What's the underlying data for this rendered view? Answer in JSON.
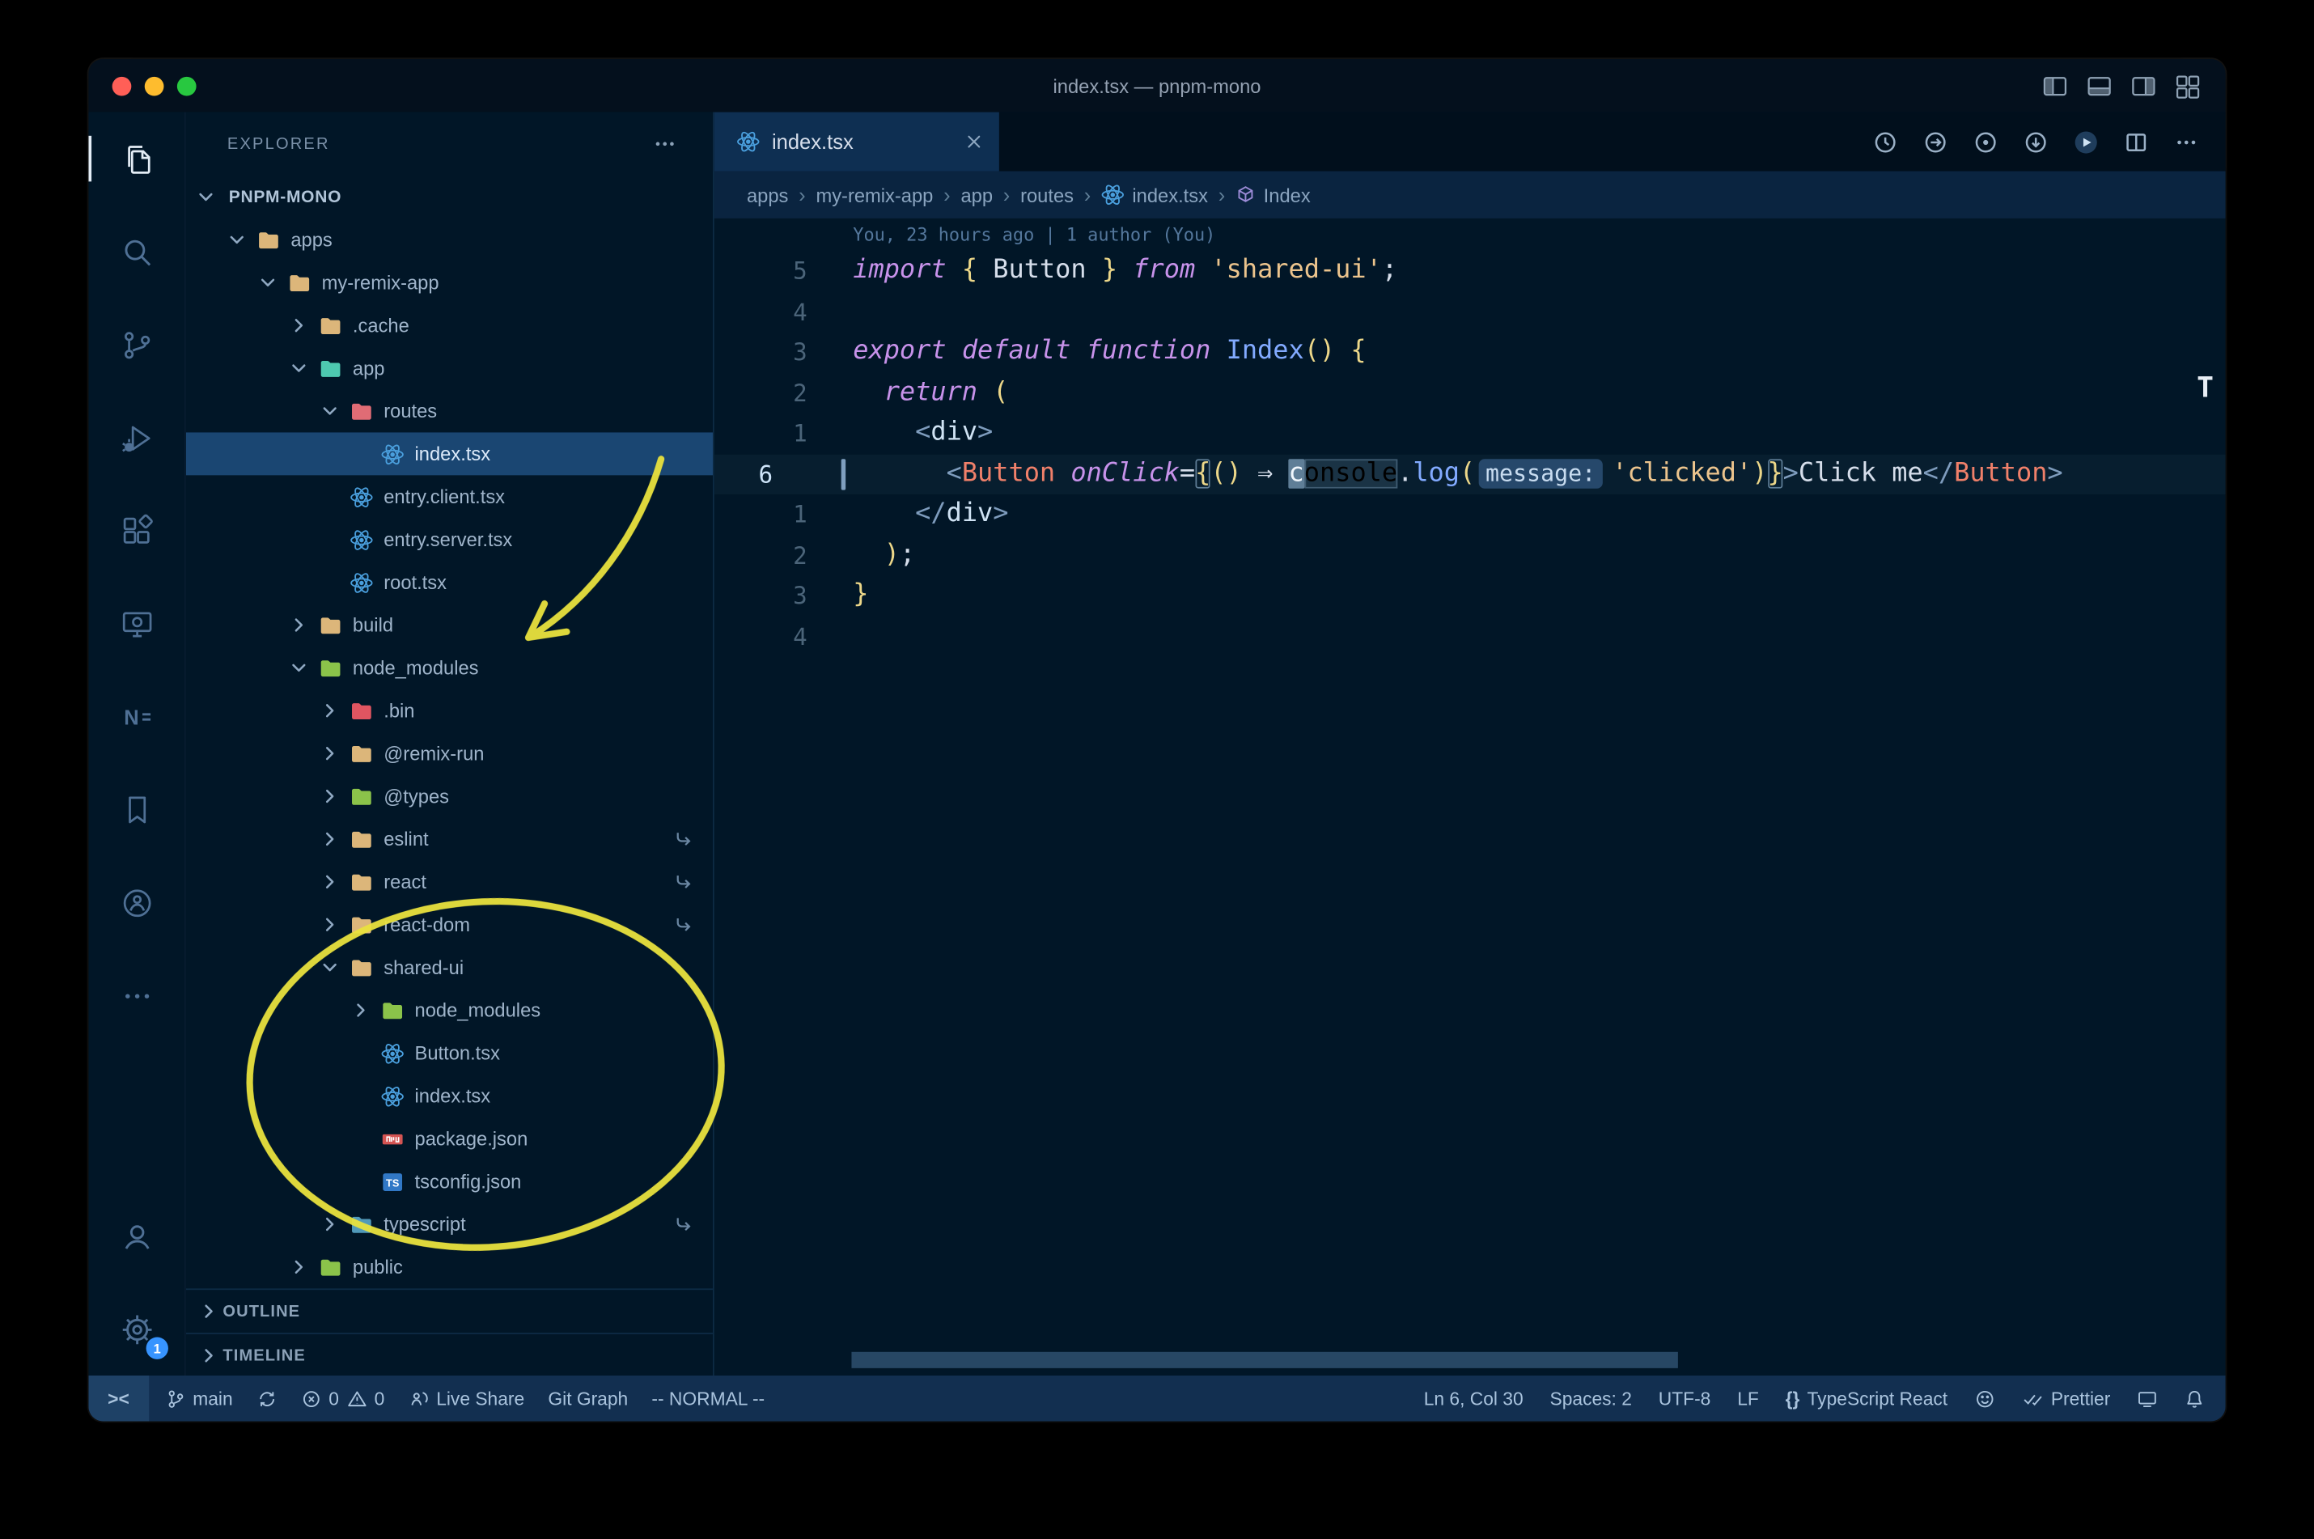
{
  "window": {
    "title": "index.tsx — pnpm-mono"
  },
  "colors": {
    "background": "#011627",
    "annotation_yellow": "#e9e23e",
    "selected_row": "#1a4672",
    "badge_blue": "#3794ff",
    "folder_default": "#dcb67a",
    "folder_node_modules": "#8bc34a",
    "folder_app": "#4ec9b0",
    "folder_routes": "#e06c75",
    "folder_bin": "#e05561",
    "folder_typescript": "#519aba",
    "react_icon": "#4a9fdd",
    "npm_icon": "#d45453",
    "ts_icon": "#3178c6",
    "keyword": "#c792ea",
    "string": "#ecc48d",
    "function": "#82aaff",
    "component": "#f0806a",
    "bracket": "#ecd789",
    "traffic_lights": [
      "#ff5f57",
      "#febc2e",
      "#28c840"
    ]
  },
  "icons_legend": {
    "remote-indicator": "><",
    "language-braces": "{}",
    "breadcrumb-separator": "›",
    "close": "×",
    "chevron-expanded": "⌄",
    "chevron-collapsed": "›",
    "symlink": "↪"
  },
  "activity_bar": {
    "top": [
      {
        "icon": "explorer",
        "active": true
      },
      {
        "icon": "search"
      },
      {
        "icon": "source-control"
      },
      {
        "icon": "run-debug"
      },
      {
        "icon": "extensions"
      },
      {
        "icon": "remote-explorer"
      },
      {
        "icon": "nx-console"
      },
      {
        "icon": "bookmarks"
      },
      {
        "icon": "live-share"
      },
      {
        "icon": "more"
      }
    ],
    "bottom": [
      {
        "icon": "accounts"
      },
      {
        "icon": "settings",
        "badge": "1"
      }
    ]
  },
  "sidebar": {
    "title": "EXPLORER",
    "bottom_sections": [
      "OUTLINE",
      "TIMELINE"
    ],
    "tree": [
      {
        "label": "PNPM-MONO",
        "depth": 0,
        "kind": "root",
        "state": "open"
      },
      {
        "label": "apps",
        "depth": 1,
        "kind": "folder",
        "color": "#dcb67a",
        "state": "open"
      },
      {
        "label": "my-remix-app",
        "depth": 2,
        "kind": "folder",
        "color": "#dcb67a",
        "state": "open"
      },
      {
        "label": ".cache",
        "depth": 3,
        "kind": "folder",
        "color": "#dcb67a",
        "state": "closed"
      },
      {
        "label": "app",
        "depth": 3,
        "kind": "folder",
        "color": "#4ec9b0",
        "state": "open"
      },
      {
        "label": "routes",
        "depth": 4,
        "kind": "folder",
        "color": "#e06c75",
        "state": "open"
      },
      {
        "label": "index.tsx",
        "depth": 5,
        "kind": "file",
        "icon": "react",
        "selected": true
      },
      {
        "label": "entry.client.tsx",
        "depth": 4,
        "kind": "file",
        "icon": "react"
      },
      {
        "label": "entry.server.tsx",
        "depth": 4,
        "kind": "file",
        "icon": "react"
      },
      {
        "label": "root.tsx",
        "depth": 4,
        "kind": "file",
        "icon": "react"
      },
      {
        "label": "build",
        "depth": 3,
        "kind": "folder",
        "color": "#dcb67a",
        "state": "closed"
      },
      {
        "label": "node_modules",
        "depth": 3,
        "kind": "folder",
        "color": "#8bc34a",
        "state": "open"
      },
      {
        "label": ".bin",
        "depth": 4,
        "kind": "folder",
        "color": "#e05561",
        "state": "closed"
      },
      {
        "label": "@remix-run",
        "depth": 4,
        "kind": "folder",
        "color": "#dcb67a",
        "state": "closed"
      },
      {
        "label": "@types",
        "depth": 4,
        "kind": "folder",
        "color": "#8bc34a",
        "state": "closed"
      },
      {
        "label": "eslint",
        "depth": 4,
        "kind": "folder",
        "color": "#dcb67a",
        "state": "closed",
        "symlink": true
      },
      {
        "label": "react",
        "depth": 4,
        "kind": "folder",
        "color": "#dcb67a",
        "state": "closed",
        "symlink": true
      },
      {
        "label": "react-dom",
        "depth": 4,
        "kind": "folder",
        "color": "#dcb67a",
        "state": "closed",
        "symlink": true
      },
      {
        "label": "shared-ui",
        "depth": 4,
        "kind": "folder",
        "color": "#dcb67a",
        "state": "open"
      },
      {
        "label": "node_modules",
        "depth": 5,
        "kind": "folder",
        "color": "#8bc34a",
        "state": "closed"
      },
      {
        "label": "Button.tsx",
        "depth": 5,
        "kind": "file",
        "icon": "react"
      },
      {
        "label": "index.tsx",
        "depth": 5,
        "kind": "file",
        "icon": "react"
      },
      {
        "label": "package.json",
        "depth": 5,
        "kind": "file",
        "icon": "npm"
      },
      {
        "label": "tsconfig.json",
        "depth": 5,
        "kind": "file",
        "icon": "ts"
      },
      {
        "label": "typescript",
        "depth": 4,
        "kind": "folder",
        "color": "#519aba",
        "state": "closed",
        "symlink": true
      },
      {
        "label": "public",
        "depth": 3,
        "kind": "folder",
        "color": "#8bc34a",
        "state": "closed"
      }
    ]
  },
  "editor": {
    "tab": {
      "label": "index.tsx",
      "icon": "react"
    },
    "actions": [
      {
        "name": "history",
        "icon": "history"
      },
      {
        "name": "open-changes",
        "icon": "open-changes"
      },
      {
        "name": "circle-dot",
        "icon": "target"
      },
      {
        "name": "circle-arrow",
        "icon": "target-arrow"
      },
      {
        "name": "run",
        "icon": "run"
      },
      {
        "name": "split-editor",
        "icon": "split"
      },
      {
        "name": "more-actions",
        "icon": "ellipsis"
      }
    ],
    "breadcrumb_separator": "›",
    "breadcrumbs": [
      {
        "label": "apps"
      },
      {
        "label": "my-remix-app"
      },
      {
        "label": "app"
      },
      {
        "label": "routes"
      },
      {
        "label": "index.tsx",
        "icon": "react"
      },
      {
        "label": "Index",
        "icon": "symbol"
      }
    ],
    "blame": "You, 23 hours ago | 1 author (You)",
    "overview_marker": "T",
    "code": {
      "lines": [
        {
          "num": "5",
          "tokens": [
            [
              "import",
              "kw"
            ],
            [
              " ",
              "pl"
            ],
            [
              "{",
              "br"
            ],
            [
              " Button ",
              "pl"
            ],
            [
              "}",
              "br"
            ],
            [
              " ",
              "pl"
            ],
            [
              "from",
              "kw"
            ],
            [
              " ",
              "pl"
            ],
            [
              "'shared-ui'",
              "str"
            ],
            [
              ";",
              "pl"
            ]
          ]
        },
        {
          "num": "4",
          "tokens": []
        },
        {
          "num": "3",
          "tokens": [
            [
              "export",
              "kw"
            ],
            [
              " ",
              "pl"
            ],
            [
              "default",
              "kw"
            ],
            [
              " ",
              "pl"
            ],
            [
              "function",
              "kw"
            ],
            [
              " ",
              "pl"
            ],
            [
              "Index",
              "fn"
            ],
            [
              "()",
              "br"
            ],
            [
              " ",
              "pl"
            ],
            [
              "{",
              "br"
            ]
          ]
        },
        {
          "num": "2",
          "tokens": [
            [
              "  ",
              "pl"
            ],
            [
              "return",
              "kw"
            ],
            [
              " ",
              "pl"
            ],
            [
              "(",
              "br"
            ]
          ]
        },
        {
          "num": "1",
          "tokens": [
            [
              "    ",
              "pl"
            ],
            [
              "<",
              "pn"
            ],
            [
              "div",
              "tag"
            ],
            [
              ">",
              "pn"
            ]
          ]
        },
        {
          "num": "6",
          "current": true,
          "tokens": [
            [
              "      ",
              "pl"
            ],
            [
              "<",
              "pn"
            ],
            [
              "Button",
              "comp"
            ],
            [
              " ",
              "pl"
            ],
            [
              "onClick",
              "attr"
            ],
            [
              "=",
              "pl"
            ],
            [
              "{",
              "br bm"
            ],
            [
              "()",
              "br"
            ],
            [
              " ",
              "pl"
            ],
            [
              "⇒",
              "pl"
            ],
            [
              " ",
              "pl"
            ],
            [
              "c",
              "cur"
            ],
            [
              "onsole",
              "wsel"
            ],
            [
              ".",
              "pl"
            ],
            [
              "log",
              "fn"
            ],
            [
              "(",
              "br"
            ],
            [
              "message:",
              "inlay"
            ],
            [
              "'clicked'",
              "str"
            ],
            [
              ")",
              "br"
            ],
            [
              "}",
              "br bm"
            ],
            [
              ">",
              "pn"
            ],
            [
              "Click me",
              "pl"
            ],
            [
              "</",
              "pn"
            ],
            [
              "Button",
              "comp"
            ],
            [
              ">",
              "pn"
            ]
          ]
        },
        {
          "num": "1",
          "tokens": [
            [
              "    ",
              "pl"
            ],
            [
              "</",
              "pn"
            ],
            [
              "div",
              "tag"
            ],
            [
              ">",
              "pn"
            ]
          ]
        },
        {
          "num": "2",
          "tokens": [
            [
              "  ",
              "pl"
            ],
            [
              ")",
              "br"
            ],
            [
              ";",
              "pl"
            ]
          ]
        },
        {
          "num": "3",
          "tokens": [
            [
              "}",
              "br"
            ]
          ]
        },
        {
          "num": "4",
          "tokens": []
        }
      ]
    }
  },
  "status_bar": {
    "left": [
      {
        "name": "remote",
        "icon_text": "><"
      },
      {
        "name": "branch",
        "icon": "branch",
        "label": "main"
      },
      {
        "name": "sync",
        "icon": "sync"
      },
      {
        "name": "problems",
        "parts": [
          {
            "icon": "error",
            "label": "0"
          },
          {
            "icon": "warning",
            "label": "0"
          }
        ]
      },
      {
        "name": "live-share",
        "icon": "share",
        "label": "Live Share"
      },
      {
        "name": "git-graph",
        "label": "Git Graph"
      },
      {
        "name": "vim-mode",
        "label": "-- NORMAL --"
      }
    ],
    "right": [
      {
        "name": "cursor-position",
        "label": "Ln 6, Col 30"
      },
      {
        "name": "indentation",
        "label": "Spaces: 2"
      },
      {
        "name": "encoding",
        "label": "UTF-8"
      },
      {
        "name": "eol",
        "label": "LF"
      },
      {
        "name": "language-mode",
        "icon_text": "{}",
        "label": "TypeScript React"
      },
      {
        "name": "feedback",
        "icon": "smiley"
      },
      {
        "name": "formatter",
        "icon": "check-double",
        "label": "Prettier"
      },
      {
        "name": "screencast",
        "icon": "screencast"
      },
      {
        "name": "notifications",
        "icon": "bell"
      }
    ]
  },
  "annotations": {
    "color": "#e9e23e",
    "shapes": [
      "hand-drawn arrow pointing to node_modules",
      "hand-drawn ellipse around shared-ui package contents"
    ]
  }
}
